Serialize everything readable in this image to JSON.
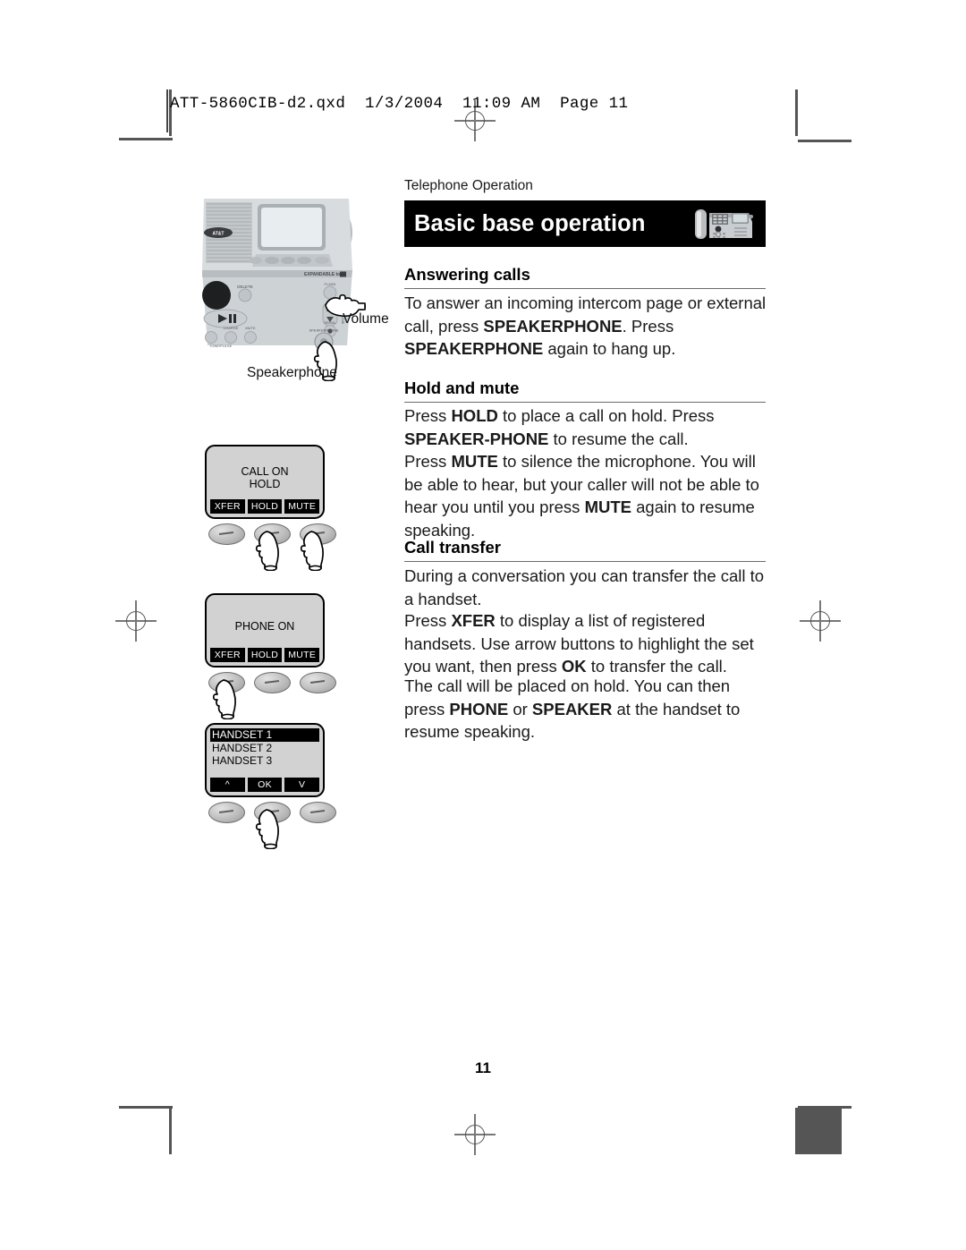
{
  "print_marks": {
    "qxd_header": "ATT-5860CIB-d2.qxd  1/3/2004  11:09 AM  Page 11"
  },
  "page": {
    "running_head": "Telephone Operation",
    "banner_title": "Basic base operation",
    "banner_icon": "corded-base-phone-icon",
    "folio": "11"
  },
  "sections": [
    {
      "heading": "Answering calls",
      "paragraphs": [
        [
          {
            "t": "To answer an incoming intercom page or external call, press ",
            "b": false
          },
          {
            "t": "SPEAKERPHONE",
            "b": true
          },
          {
            "t": ". Press ",
            "b": false
          },
          {
            "t": "SPEAKERPHONE",
            "b": true
          },
          {
            "t": " again to hang up.",
            "b": false
          }
        ]
      ]
    },
    {
      "heading": "Hold and mute",
      "paragraphs": [
        [
          {
            "t": "Press ",
            "b": false
          },
          {
            "t": "HOLD",
            "b": true
          },
          {
            "t": " to place a call on hold. Press ",
            "b": false
          },
          {
            "t": "SPEAKER-PHONE",
            "b": true
          },
          {
            "t": " to resume the call.",
            "b": false
          }
        ],
        [
          {
            "t": "Press ",
            "b": false
          },
          {
            "t": "MUTE",
            "b": true
          },
          {
            "t": " to silence the microphone. You will be able to hear, but your caller will not be able to hear you until you press ",
            "b": false
          },
          {
            "t": "MUTE",
            "b": true
          },
          {
            "t": " again to resume speaking.",
            "b": false
          }
        ]
      ]
    },
    {
      "heading": "Call transfer",
      "paragraphs": [
        [
          {
            "t": "During a conversation you can transfer the call to a handset.",
            "b": false
          }
        ],
        [
          {
            "t": "Press ",
            "b": false
          },
          {
            "t": "XFER",
            "b": true
          },
          {
            "t": " to display a list of registered handsets. Use arrow buttons to highlight the set you want, then press ",
            "b": false
          },
          {
            "t": "OK",
            "b": true
          },
          {
            "t": " to transfer the call.",
            "b": false
          }
        ],
        [
          {
            "t": "The call will be placed on hold. You can then press ",
            "b": false
          },
          {
            "t": "PHONE",
            "b": true
          },
          {
            "t": " or ",
            "b": false
          },
          {
            "t": "SPEAKER",
            "b": true
          },
          {
            "t": " at the handset to resume speaking.",
            "b": false
          }
        ]
      ]
    }
  ],
  "illustrations": {
    "base_photo": {
      "name": "phone-base-photo",
      "callouts": [
        {
          "label": "Volume",
          "pointer": "hand-pointing-right"
        },
        {
          "label": "Speakerphone",
          "pointer": "hand-pointing-up"
        }
      ],
      "base_markings": [
        "AT&T",
        "DELETE",
        "EXPANDABLE to",
        "FLASH",
        "VOL",
        "MUTE",
        "SPEAKERPHONE",
        "CHARGE"
      ]
    },
    "lcd_screens": [
      {
        "name": "call-on-hold-screen",
        "display_lines": [
          "CALL ON",
          "HOLD"
        ],
        "softkeys": [
          "XFER",
          "HOLD",
          "MUTE"
        ],
        "pressed": [
          "HOLD",
          "MUTE"
        ]
      },
      {
        "name": "phone-on-screen",
        "display_lines": [
          "PHONE ON"
        ],
        "softkeys": [
          "XFER",
          "HOLD",
          "MUTE"
        ],
        "pressed": [
          "XFER"
        ]
      },
      {
        "name": "handset-list-screen",
        "list_items": [
          "HANDSET 1",
          "HANDSET 2",
          "HANDSET 3"
        ],
        "selected_index": 0,
        "softkeys": [
          "^",
          "OK",
          "V"
        ],
        "pressed": [
          "OK"
        ]
      }
    ]
  },
  "colors": {
    "banner_bg": "#000000",
    "banner_text": "#ffffff",
    "rule": "#6b6b6b",
    "lcd_bg": "#d2d2d2",
    "body_text": "#1a1a1a"
  }
}
